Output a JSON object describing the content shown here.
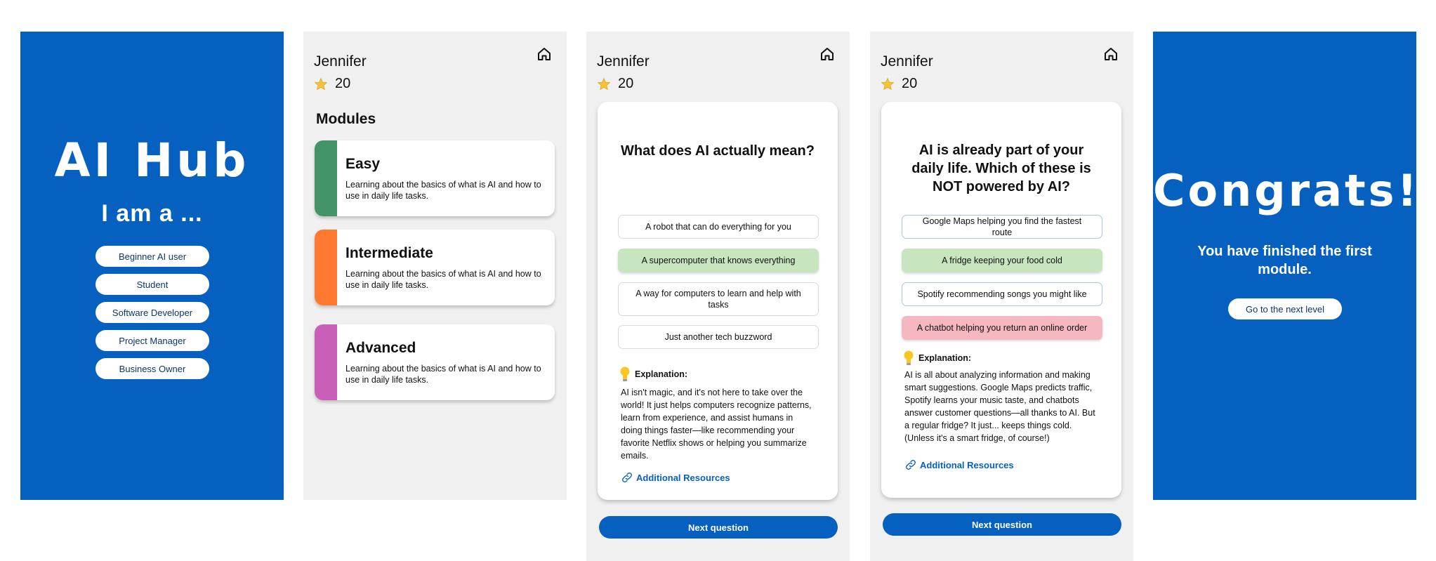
{
  "welcome": {
    "title": "AI Hub",
    "subtitle": "I am a ...",
    "roles": [
      "Beginner AI user",
      "Student",
      "Software Developer",
      "Project Manager",
      "Business Owner"
    ]
  },
  "user": {
    "name": "Jennifer",
    "score": "20"
  },
  "modules_screen": {
    "heading": "Modules",
    "modules": [
      {
        "title": "Easy",
        "desc": "Learning about the basics of what is AI and how to use in daily life tasks.",
        "color": "#449467"
      },
      {
        "title": "Intermediate",
        "desc": "Learning about the basics of what is AI and how to use in daily life tasks.",
        "color": "#FF7A30"
      },
      {
        "title": "Advanced",
        "desc": "Learning about the basics of what is AI and how to use in daily life tasks.",
        "color": "#C95FB8"
      }
    ]
  },
  "question1": {
    "question": "What does AI actually mean?",
    "options": [
      "A robot that can do everything for you",
      "A supercomputer that knows everything",
      "A way for computers to learn and help with tasks",
      "Just another tech buzzword"
    ],
    "explanation_heading": "Explanation:",
    "explanation": "AI isn't magic, and it's not here to take over the world! It just helps computers recognize patterns, learn from experience, and assist humans in doing things faster—like recommending your favorite Netflix shows or helping you summarize emails.",
    "resources": "Additional Resources",
    "next": "Next question"
  },
  "question2": {
    "question": "AI is already part of your daily life. Which of these is NOT powered by AI?",
    "options": [
      "Google Maps helping you find the fastest route",
      "A fridge keeping your food cold",
      "Spotify recommending songs you might like",
      "A chatbot helping you return an online order"
    ],
    "explanation_heading": "Explanation:",
    "explanation": "AI is all about analyzing information and making smart suggestions. Google Maps predicts traffic, Spotify learns your music taste, and chatbots answer customer questions—all thanks to AI. But a regular fridge? It just... keeps things cold. (Unless it's a smart fridge, of course!)",
    "resources": "Additional Resources",
    "next": "Next question"
  },
  "congrats": {
    "title": "Congrats!",
    "message": "You have finished the first module.",
    "button": "Go to the next level"
  },
  "colors": {
    "primary": "#0560C0",
    "correct": "#C7E6C0",
    "wrong": "#F6B8C0",
    "panel_grey": "#F0F0F0"
  },
  "icons": {
    "home": "home-icon",
    "star": "star-icon",
    "bulb": "lightbulb-icon",
    "link": "link-icon"
  }
}
